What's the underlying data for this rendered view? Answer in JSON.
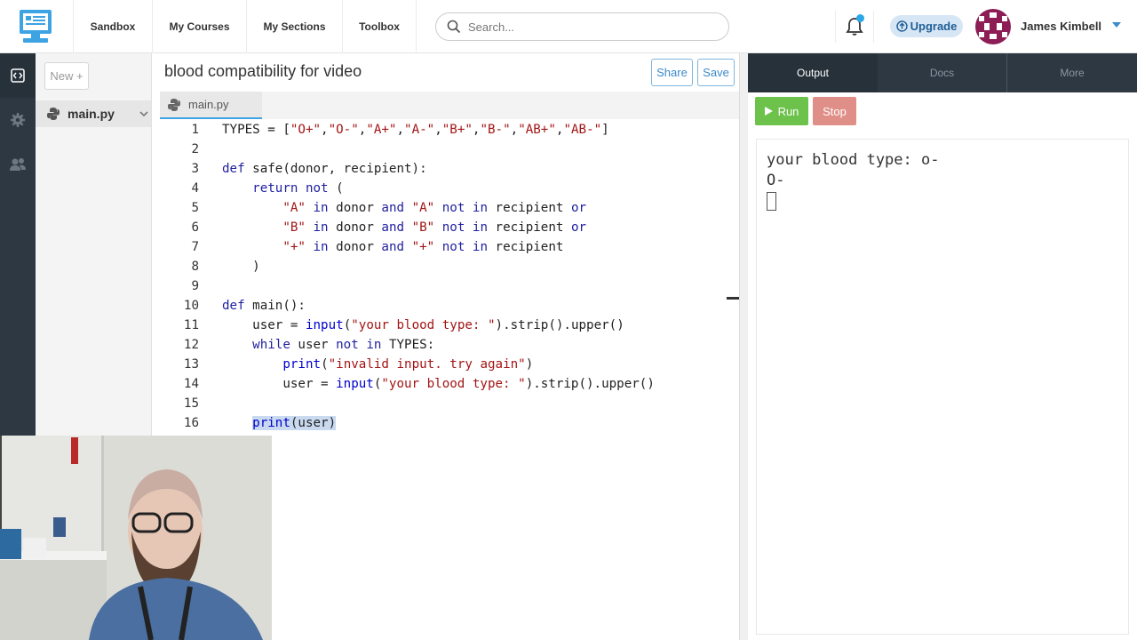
{
  "nav": {
    "items": [
      "Sandbox",
      "My Courses",
      "My Sections",
      "Toolbox"
    ],
    "search_placeholder": "Search...",
    "upgrade_label": "Upgrade",
    "user_name": "James Kimbell"
  },
  "sidebar": {
    "new_label": "New +",
    "file_name": "main.py"
  },
  "editor": {
    "project_title": "blood compatibility for video",
    "share_label": "Share",
    "save_label": "Save",
    "tab_label": "main.py",
    "line_numbers": [
      "1",
      "2",
      "3",
      "4",
      "5",
      "6",
      "7",
      "8",
      "9",
      "10",
      "11",
      "12",
      "13",
      "14",
      "15",
      "16"
    ]
  },
  "output": {
    "tabs": [
      "Output",
      "Docs",
      "More"
    ],
    "run_label": "Run",
    "stop_label": "Stop",
    "lines": [
      "your blood type: o-",
      "O-"
    ]
  },
  "colors": {
    "rail": "#2e3842",
    "run": "#6cc24a",
    "stop": "#e08f88",
    "accent": "#3da3e3"
  }
}
